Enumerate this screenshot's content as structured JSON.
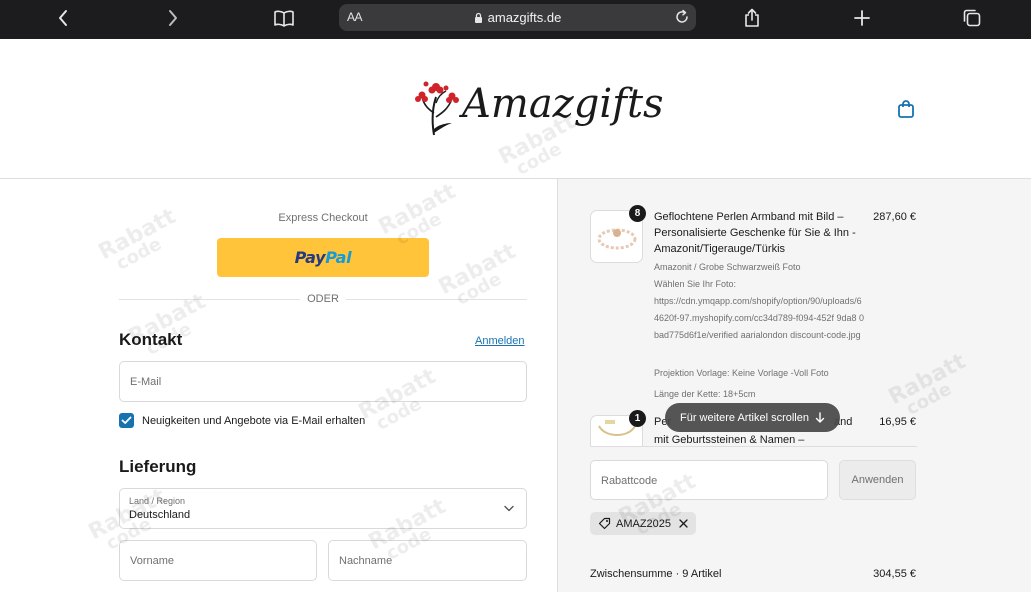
{
  "browser": {
    "text_size_label": "AA",
    "url": "amazgifts.de"
  },
  "header": {
    "logo_text": "Amazgifts"
  },
  "checkout": {
    "express_label": "Express Checkout",
    "paypal_label_1": "Pay",
    "paypal_label_2": "Pal",
    "divider_label": "ODER",
    "contact_title": "Kontakt",
    "login_link": "Anmelden",
    "email_placeholder": "E-Mail",
    "newsletter_label": "Neuigkeiten und Angebote via E-Mail erhalten",
    "newsletter_checked": true,
    "delivery_title": "Lieferung",
    "country_label": "Land / Region",
    "country_value": "Deutschland",
    "first_name_placeholder": "Vorname",
    "last_name_placeholder": "Nachname"
  },
  "summary": {
    "items": [
      {
        "qty": "8",
        "title": "Geflochtene Perlen Armband mit Bild – Personalisierte Geschenke für Sie & Ihn - Amazonit/Tigerauge/Türkis",
        "price": "287,60 €",
        "variant": "Amazonit / Grobe Schwarzweiß Foto",
        "photo_label": "Wählen Sie Ihr Foto:",
        "photo_url": "https://cdn.ymqapp.com/shopify/option/90/uploads/64620f-97.myshopify.com/cc34d789-f094-452f 9da8 0bad775d6f1e/verified aarialondon discount-code.jpg",
        "projection": "Projektion Vorlage: Keine Vorlage -Voll Foto",
        "chain_length": "Länge der Kette: 18+5cm"
      },
      {
        "qty": "1",
        "title_start": "Per",
        "title_end": "and",
        "title_line2": "mit Geburtssteinen & Namen –",
        "price": "16,95 €"
      }
    ],
    "scroll_hint": "Für weitere Artikel scrollen",
    "discount_placeholder": "Rabattcode",
    "apply_label": "Anwenden",
    "applied_code": "AMAZ2025",
    "subtotal_label": "Zwischensumme · 9 Artikel",
    "subtotal_value": "304,55 €"
  },
  "colors": {
    "paypal_yellow": "#ffc439",
    "link_blue": "#1773b0",
    "browser_bar": "#1c1c1e",
    "summary_bg": "#f5f5f5"
  },
  "icons": [
    "back-icon",
    "forward-icon",
    "bookmarks-icon",
    "lock-icon",
    "reload-icon",
    "share-icon",
    "new-tab-icon",
    "tabs-icon",
    "shopping-bag-icon",
    "tag-icon",
    "close-icon",
    "chevron-down-icon",
    "arrow-down-icon"
  ]
}
